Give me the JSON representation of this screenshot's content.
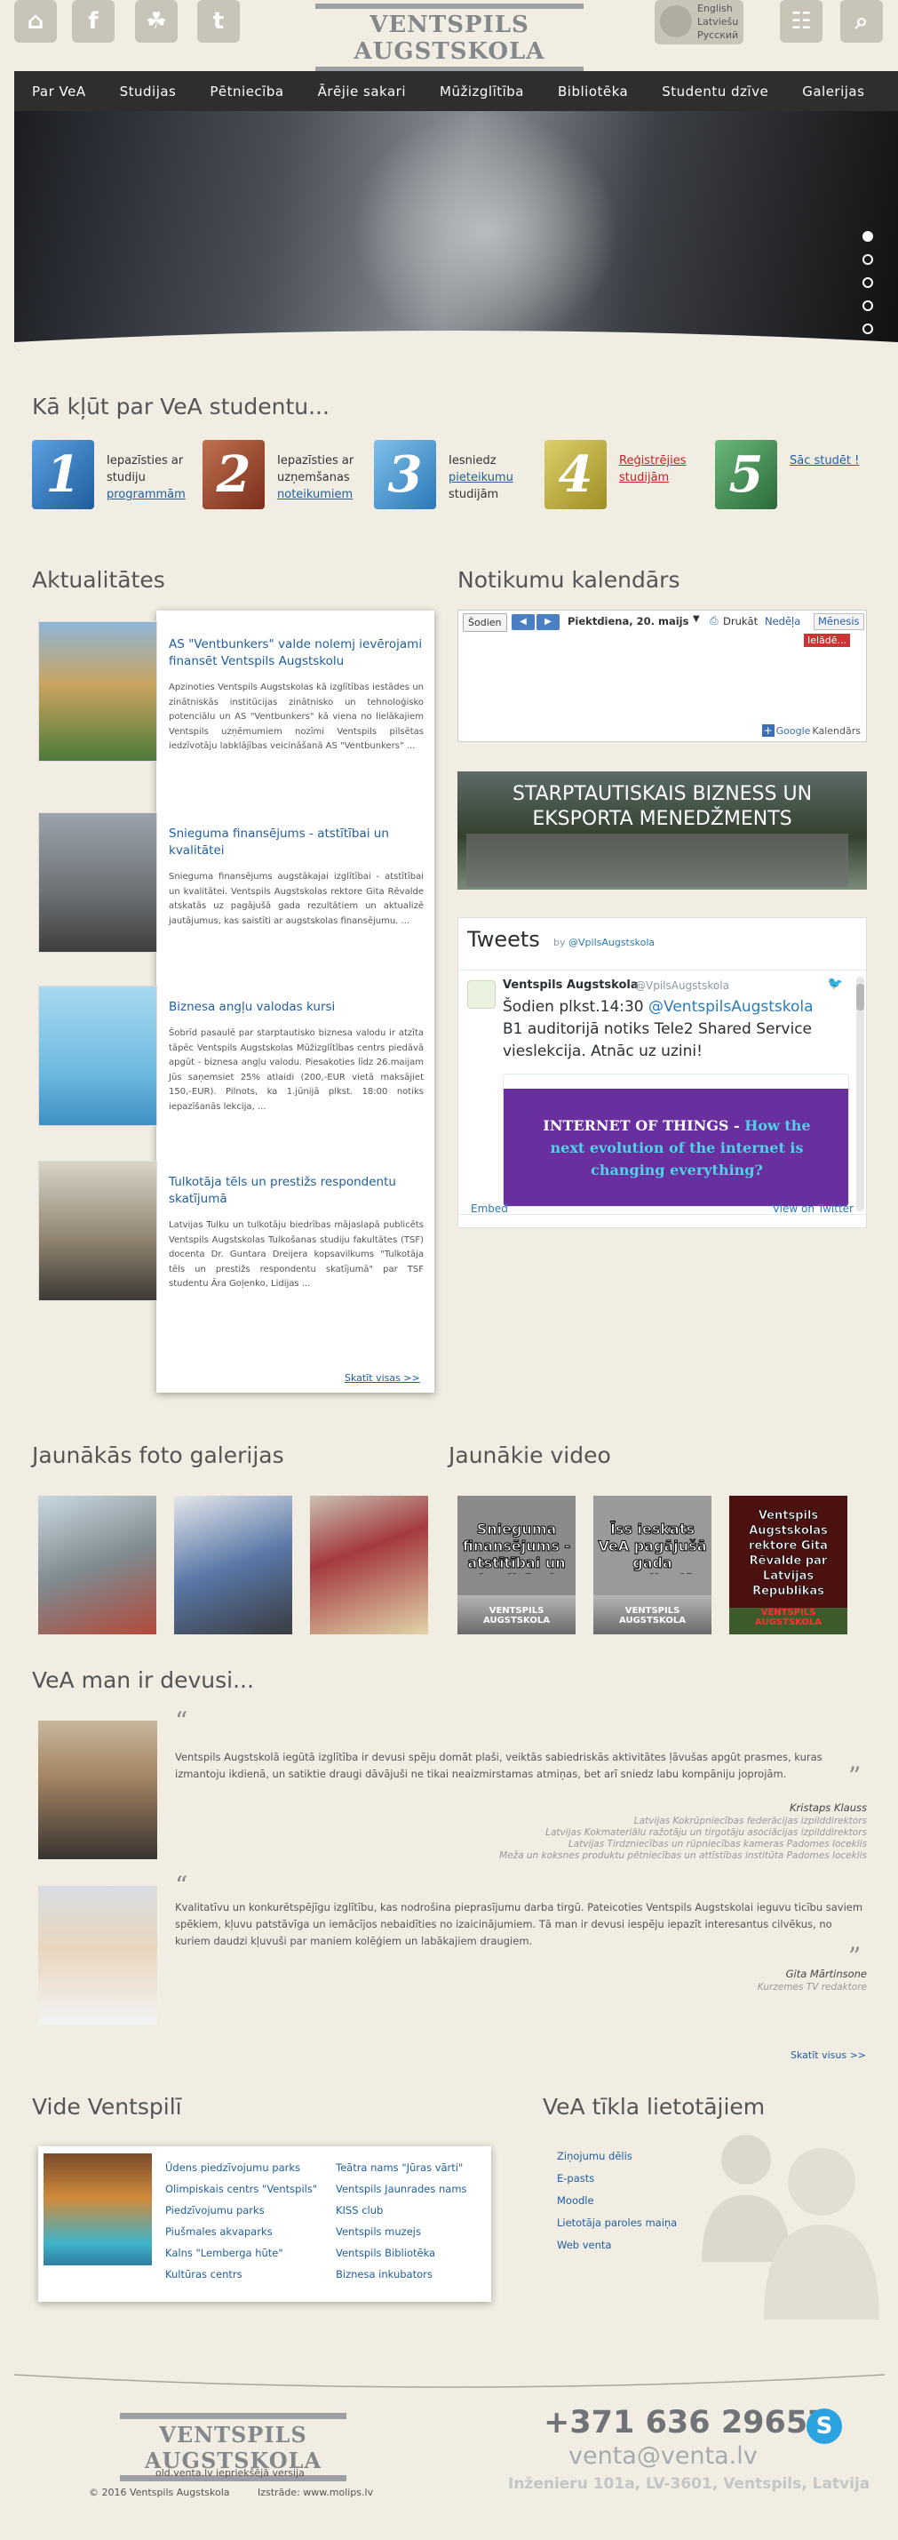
{
  "header": {
    "icons": [
      "home-icon",
      "facebook-icon",
      "draugiem-icon",
      "twitter-icon",
      "sitemap-icon",
      "search-icon"
    ],
    "logo": "VENTSPILS AUGSTSKOLA",
    "languages": [
      "English",
      "Latviešu",
      "Русский"
    ]
  },
  "nav": [
    "Par VeA",
    "Studijas",
    "Pētniecība",
    "Ārējie sakari",
    "Mūžizglītība",
    "Bibliotēka",
    "Studentu dzīve",
    "Galerijas"
  ],
  "hero": {
    "slides": 5,
    "active_slide": 1
  },
  "steps": {
    "title": "Kā kļūt par VeA studentu...",
    "items": [
      {
        "num": "1",
        "text1": "Iepazīsties ar studiju",
        "link": "programmām"
      },
      {
        "num": "2",
        "text1": "Iepazīsties ar uzņemšanas",
        "link": "noteikumiem"
      },
      {
        "num": "3",
        "text1": "Iesniedz",
        "link": "pieteikumu",
        "text2": "studijām"
      },
      {
        "num": "4",
        "link": "Reģistrējies studijām"
      },
      {
        "num": "5",
        "link": "Sāc studēt !"
      }
    ]
  },
  "news": {
    "title": "Aktualitātes",
    "items": [
      {
        "title": "AS \"Ventbunkers\" valde nolemj ievērojami finansēt Ventspils Augstskolu",
        "body": "Apzinoties Ventspils Augstskolas kā izglītības iestādes un zinātniskās institūcijas zinātnisko un tehnoloģisko potenciālu un AS \"Ventbunkers\" kā viena no lielākajiem Ventspils uzņēmumiem nozīmi Ventspils pilsētas iedzīvotāju labklājības veicināšanā AS \"Ventbunkers\" ..."
      },
      {
        "title": "Snieguma finansējums - atstītībai un kvalitātei",
        "body": "Snieguma finansējums augstākajai izglītībai - atstītībai un kvalitātei. Ventspils Augstskolas rektore Gita Rēvalde atskatās uz pagājušā gada rezultātiem un aktualizē jautājumus, kas saistīti ar augstskolas finansējumu.    ..."
      },
      {
        "title": "Biznesa angļu valodas kursi",
        "body": "Šobrīd pasaulē par starptautisko biznesa valodu ir atzīta tāpēc Ventspils Augstskolas Mūžizglītības centrs piedāvā apgūt - biznesa angļu valodu. Piesakoties līdz 26.maijam Jūs saņemsiet 25% atlaidi (200,-EUR vietā maksājiet 150,-EUR). Pilnots, ka 1.jūnijā plkst. 18:00 notiks iepazīšanās lekcija, ..."
      },
      {
        "title": "Tulkotāja tēls un prestižs respondentu skatījumā",
        "body": "Latvijas Tulku un tulkotāju biedrības mājaslapā publicēts Ventspils Augstskolas Tulkošanas studiju fakultātes (TSF) docenta Dr. Guntara Dreijera kopsavilkums \"Tulkotāja tēls un prestižs respondentu skatījumā\" par TSF studentu Āra Goļenko, Lidijas ..."
      }
    ],
    "more": "Skatīt visas >>"
  },
  "calendar": {
    "title": "Notikumu kalendārs",
    "today": "Šodien",
    "date": "Piektdiena, 20. maijs",
    "print": "Drukāt",
    "week": "Nedēļa",
    "month": "Mēnesis",
    "loading": "Ielādē...",
    "brand": "Google",
    "brand_suffix": "Kalendārs"
  },
  "banner": {
    "text": "STARPTAUTISKAIS BIZNESS UN EKSPORTA MENEDŽMENTS"
  },
  "tweets": {
    "title": "Tweets",
    "by": "by",
    "handle": "@VpilsAugstskola",
    "author": "Ventspils Augstskola",
    "author_handle": "@VpilsAugstskola",
    "text": "Šodien plkst.14:30 ",
    "mention": "@VentspilsAugstskola",
    "text2": " B1 auditorijā notiks Tele2 Shared Service vieslekcija. Atnāc uz uzini!",
    "card_a": "INTERNET OF THINGS - ",
    "card_b": "How the next evolution of the internet is changing everything?",
    "embed": "Embed",
    "view": "View on Twitter"
  },
  "galleries": {
    "title": "Jaunākās foto galerijas",
    "count": 3
  },
  "videos": {
    "title": "Jaunākie video",
    "items": [
      {
        "caption": "Snieguma finansējums - atstītībai un kvalitātei",
        "logo": "VENTSPILS AUGSTSKOLA"
      },
      {
        "caption": "Īss ieskats VeA pagājušā gada paveiktajā",
        "logo": "VENTSPILS AUGSTSKOLA"
      },
      {
        "caption": "Ventspils Augstskolas rektore Gita Rēvalde par Latvijas Republikas neatkarības deklarācijas atjaunošanas gadadienu",
        "logo": "VENTSPILS AUGSTSKOLA"
      }
    ]
  },
  "testimonials": {
    "title": "VeA man ir devusi...",
    "items": [
      {
        "text": "Ventspils Augstskolā iegūtā izglītība ir devusi spēju domāt plaši, veiktās sabiedriskās aktivitātes ļāvušas apgūt prasmes, kuras izmantoju ikdienā, un satiktie draugi dāvājuši ne tikai neaizmirstamas atmiņas, bet arī sniedz labu kompāniju joprojām.",
        "name": "Kristaps Klauss",
        "roles": [
          "Latvijas Kokrūpniecības federācijas izpilddirektors",
          "Latvijas Kokmateriālu ražotāju un tirgotāju asociācijas izpilddirektors",
          "Latvijas Tirdzniecības un rūpniecības kameras Padomes loceklis",
          "Meža un koksnes produktu pētniecības un attīstības institūta Padomes loceklis"
        ]
      },
      {
        "text": "Kvalitatīvu un konkurētspējīgu izglītību, kas nodrošina pieprasījumu darba tirgū. Pateicoties Ventspils Augstskolai ieguvu ticību saviem spēkiem, kļuvu patstāvīga un iemācījos nebaidīties no izaicinājumiem. Tā man ir devusi iespēju iepazīt interesantus cilvēkus, no kuriem daudzi kļuvuši par maniem kolēģiem un labākajiem draugiem.",
        "name": "Gita Mārtinsone",
        "roles": [
          "Kurzemes TV redaktore"
        ]
      }
    ],
    "more": "Skatīt visus >>"
  },
  "vide": {
    "title": "Vide Ventspilī",
    "col1": [
      "Ūdens piedzīvojumu parks",
      "Olimpiskais centrs \"Ventspils\"",
      "Piedzīvojumu parks",
      "Piušmales akvaparks",
      "Kalns \"Lemberga hūte\"",
      "Kultūras centrs"
    ],
    "col2": [
      "Teātra nams \"Jūras vārti\"",
      "Ventspils Jaunrades nams",
      "KISS club",
      "Ventspils muzejs",
      "Ventspils Bibliotēka",
      "Biznesa inkubators"
    ]
  },
  "network": {
    "title": "VeA tīkla lietotājiem",
    "links": [
      "Ziņojumu dēlis",
      "E-pasts",
      "Moodle",
      "Lietotāja paroles maiņa",
      "Web venta"
    ]
  },
  "footer": {
    "logo": "VENTSPILS AUGSTSKOLA",
    "old": "old.venta.lv iepriekšējā versija",
    "copy": "© 2016 Ventspils Augstskola",
    "made": "Izstrāde: www.molips.lv",
    "phone": "+371 636 29657",
    "email": "venta@venta.lv",
    "address": "Inženieru 101a, LV-3601, Ventspils, Latvija"
  },
  "colors": {
    "nav_bg": "#2e2e2e",
    "link": "#1f5fa0",
    "page_bg": "#f1ede2",
    "step1": "#1f5d9c",
    "step2": "#7a2e1a",
    "step3": "#2a78b8",
    "step4": "#9d8f22",
    "step5": "#2b6a3a"
  }
}
